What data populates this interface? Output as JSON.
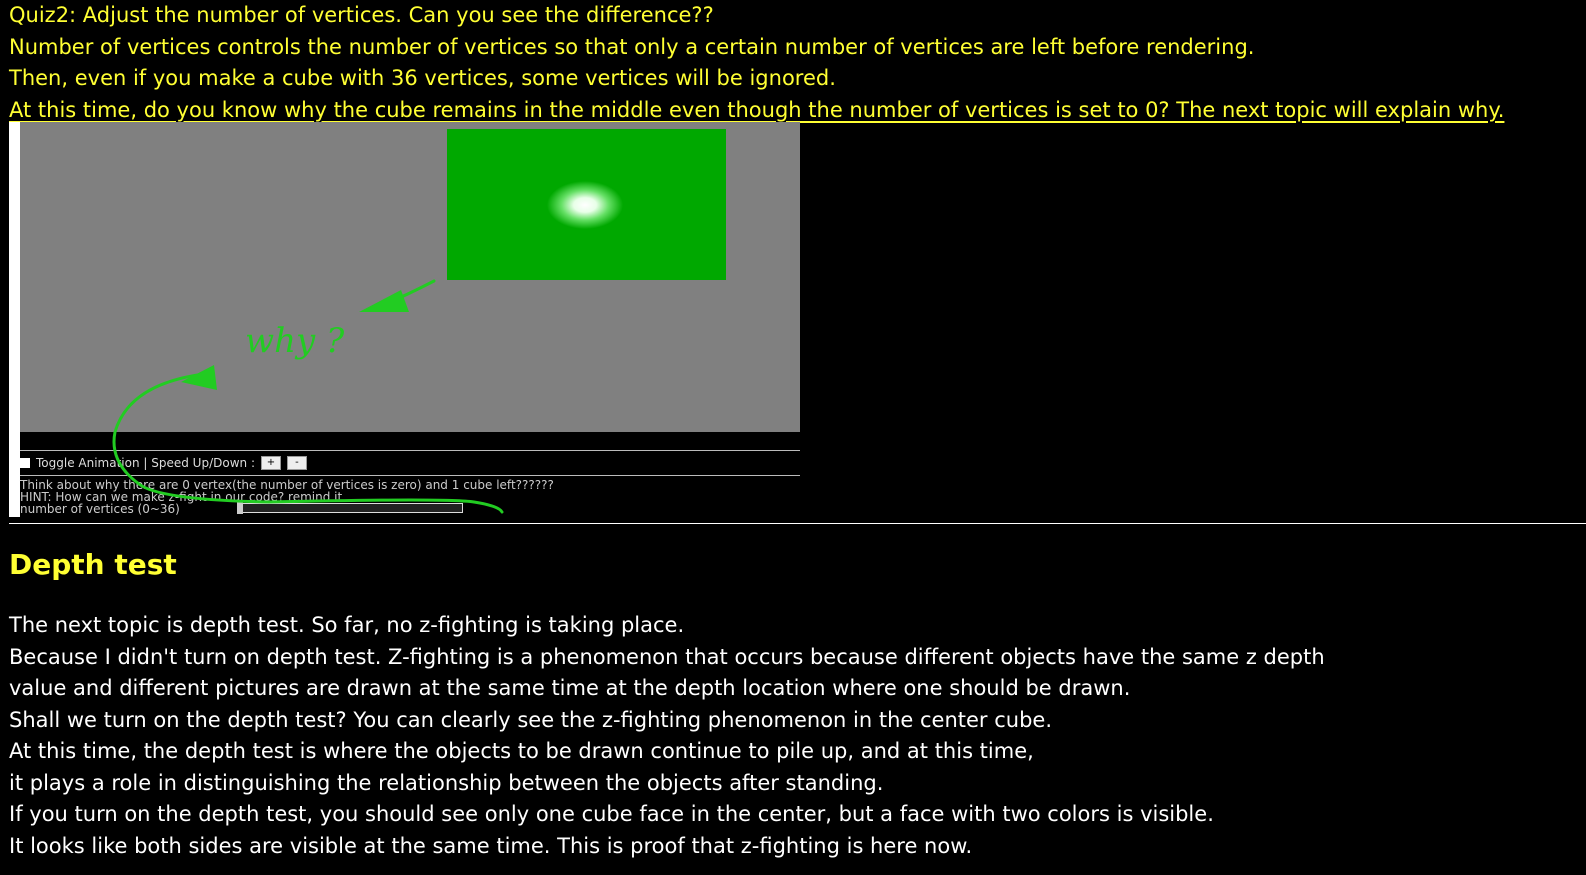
{
  "quiz": {
    "lines": [
      "Quiz2: Adjust the number of vertices. Can you see the difference??",
      "Number of vertices controls the number of vertices so that only a certain number of vertices are left before rendering.",
      "Then, even if you make a cube with 36 vertices, some vertices will be ignored.",
      "At this time, do you know why the cube remains in the middle even though the number of vertices is set to 0? The next topic will explain why."
    ]
  },
  "demo": {
    "toggle_label": "Toggle Animation | Speed Up/Down :",
    "speed_up_label": "+",
    "speed_down_label": "-",
    "question_text": "Think about why there are 0 vertex(the number of vertices is zero) and 1 cube left??????",
    "hint_text": "HINT: How can we make z-fight in our code? remind it",
    "slider_label": "number of vertices (0~36)",
    "slider_fraction": 0.0,
    "annotation_text": "why ?",
    "colors": {
      "cube": "#00a800",
      "annotation": "#22cc22",
      "slider": "#e8e020"
    }
  },
  "section": {
    "heading": "Depth test",
    "lines": [
      "The next topic is depth test. So far, no z-fighting is taking place.",
      "Because I didn't turn on depth test. Z-fighting is a phenomenon that occurs because different objects have the same z depth",
      "value and different pictures are drawn at the same time at the depth location where one should be drawn.",
      "Shall we turn on the depth test? You can clearly see the z-fighting phenomenon in the center cube.",
      "At this time, the depth test is where the objects to be drawn continue to pile up, and at this time,",
      "it plays a role in distinguishing the relationship between the objects after standing.",
      "If you turn on the depth test, you should see only one cube face in the center, but a face with two colors is visible.",
      "It looks like both sides are visible at the same time. This is proof that z-fighting is here now."
    ]
  }
}
